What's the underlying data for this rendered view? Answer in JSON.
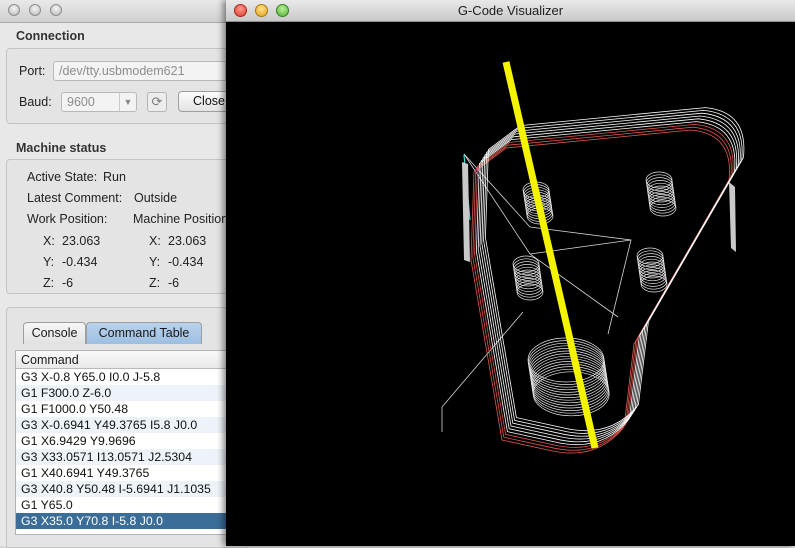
{
  "main_window": {
    "connection": {
      "title": "Connection",
      "port_label": "Port:",
      "port_value": "/dev/tty.usbmodem621",
      "baud_label": "Baud:",
      "baud_value": "9600",
      "refresh_icon": "refresh-icon",
      "close_label": "Close"
    },
    "machine_status": {
      "title": "Machine status",
      "active_state_label": "Active State:",
      "active_state_value": "Run",
      "latest_comment_label": "Latest Comment:",
      "latest_comment_value": "Outside",
      "work_position_label": "Work Position:",
      "machine_position_label": "Machine Position",
      "work": {
        "x_label": "X:",
        "x": "23.063",
        "y_label": "Y:",
        "y": "-0.434",
        "z_label": "Z:",
        "z": "-6"
      },
      "machine": {
        "x_label": "X:",
        "x": "23.063",
        "y_label": "Y:",
        "y": "-0.434",
        "z_label": "Z:",
        "z": "-6"
      }
    },
    "tabs": [
      {
        "label": "Console",
        "active": false
      },
      {
        "label": "Command Table",
        "active": true
      }
    ],
    "command_table": {
      "header": "Command",
      "rows": [
        "G3 X-0.8 Y65.0 I0.0 J-5.8",
        "G1 F300.0 Z-6.0",
        "G1 F1000.0 Y50.48",
        "G3 X-0.6941 Y49.3765 I5.8 J0.0",
        "G1 X6.9429 Y9.9696",
        "G3 X33.0571 I13.0571 J2.5304",
        "G1 X40.6941 Y49.3765",
        "G3 X40.8 Y50.48 I-5.6941 J1.1035",
        "G1 Y65.0",
        "G3 X35.0 Y70.8 I-5.8 J0.0"
      ],
      "selected_index": 9
    }
  },
  "visualizer": {
    "title": "G-Code Visualizer",
    "colors": {
      "background": "#000000",
      "path": "#ffffff",
      "cut": "#e0584e",
      "tool": "#f4f400",
      "rapid": "#40e0e0"
    }
  }
}
